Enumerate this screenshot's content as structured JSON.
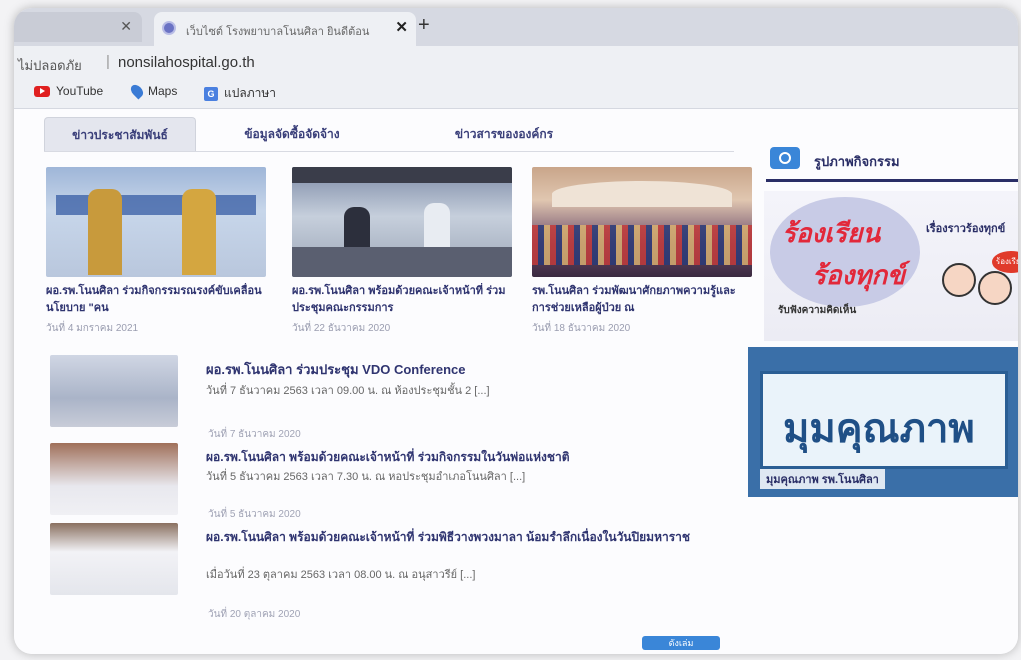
{
  "browser": {
    "tabs": [
      {
        "title": ""
      },
      {
        "title": "เว็บไซต์ โรงพยาบาลโนนศิลา ยินดีต้อน"
      }
    ],
    "new_tab_symbol": "+",
    "address_bar": {
      "security_label": "ไม่ปลอดภัย",
      "url": "nonsilahospital.go.th"
    },
    "bookmarks": [
      {
        "label": "YouTube",
        "icon": "youtube-icon"
      },
      {
        "label": "Maps",
        "icon": "maps-pin-icon"
      },
      {
        "label": "แปลภาษา",
        "icon": "translate-icon"
      }
    ]
  },
  "content_tabs": [
    {
      "label": "ข่าวประชาสัมพันธ์"
    },
    {
      "label": "ข้อมูลจัดซื้อจัดจ้าง"
    },
    {
      "label": "ข่าวสารขององค์กร"
    }
  ],
  "featured": [
    {
      "title": "ผอ.รพ.โนนศิลา ร่วมกิจกรรมรณรงค์ขับเคลื่อนนโยบาย \"คน",
      "date": "วันที่ 4 มกราคม 2021"
    },
    {
      "title": "ผอ.รพ.โนนศิลา พร้อมด้วยคณะเจ้าหน้าที่ ร่วมประชุมคณะกรรมการ",
      "date": "วันที่ 22 ธันวาคม 2020"
    },
    {
      "title": "รพ.โนนศิลา ร่วมพัฒนาศักยภาพความรู้และการช่วยเหลือผู้ป่วย ณ",
      "date": "วันที่ 18 ธันวาคม 2020"
    }
  ],
  "news_list": [
    {
      "title_prefix": "ผอ.รพ.โนนศิลา ร่วมประชุม",
      "title_suffix": "VDO Conference",
      "desc": "วันที่ 7 ธันวาคม 2563 เวลา 09.00 น. ณ ห้องประชุมชั้น 2 [...]",
      "date": "วันที่ 7 ธันวาคม 2020"
    },
    {
      "title": "ผอ.รพ.โนนศิลา พร้อมด้วยคณะเจ้าหน้าที่ ร่วมกิจกรรมในวันพ่อแห่งชาติ",
      "desc": "วันที่ 5 ธันวาคม 2563 เวลา 7.30 น. ณ หอประชุมอำเภอโนนศิลา [...]",
      "date": "วันที่ 5 ธันวาคม 2020"
    },
    {
      "title": "ผอ.รพ.โนนศิลา พร้อมด้วยคณะเจ้าหน้าที่ ร่วมพิธีวางพวงมาลา น้อมรำลึกเนื่องในวันปิยมหาราช",
      "desc": "เมื่อวันที่ 23 ตุลาคม 2563 เวลา 08.00 น. ณ อนุสาวรีย์ [...]",
      "date": "วันที่ 20 ตุลาคม 2020"
    }
  ],
  "sidebar": {
    "title": "รูปภาพกิจกรรม",
    "banner1": {
      "line1": "ร้องเรียน",
      "line2": "ร้องทุกข์",
      "side": "เรื่องราวร้องทุกข์",
      "sub": "รับฟังความคิดเห็น",
      "badge": "ร้องเรียน"
    },
    "banner2": {
      "main": "มุมคุณภาพ",
      "foot": "มุมคุณภาพ รพ.โนนศิลา"
    }
  },
  "next_button": "ดังเล่ม"
}
